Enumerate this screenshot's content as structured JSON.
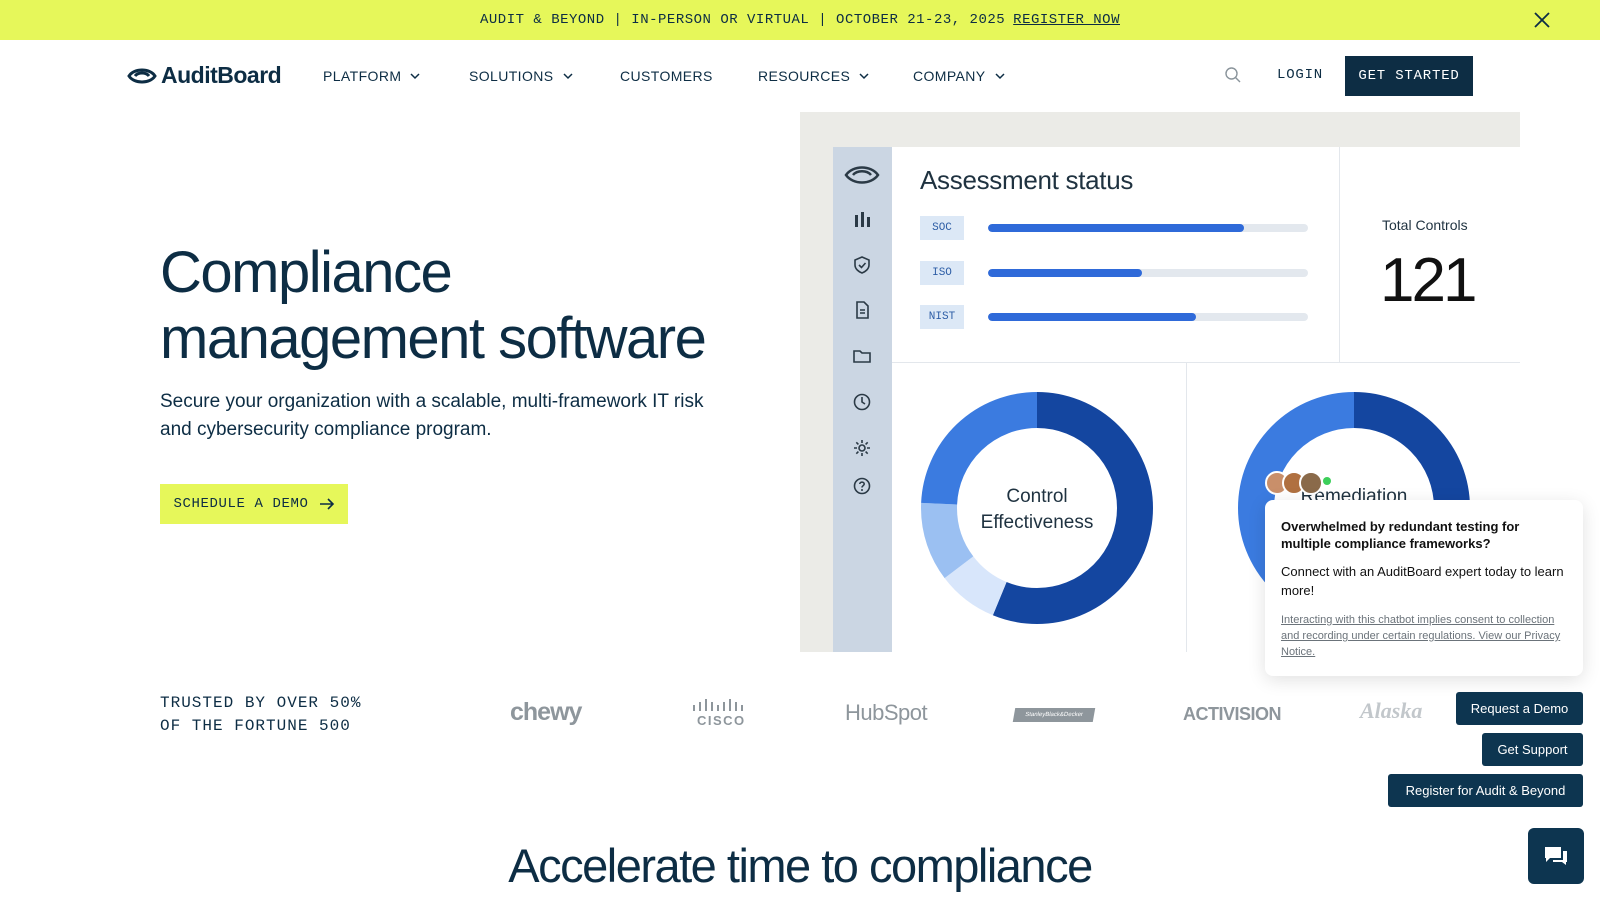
{
  "banner": {
    "text": "AUDIT & BEYOND | IN-PERSON OR VIRTUAL | OCTOBER 21-23, 2025",
    "link": "REGISTER NOW"
  },
  "nav": {
    "logo": "AuditBoard",
    "items": [
      {
        "label": "PLATFORM",
        "has_dropdown": true
      },
      {
        "label": "SOLUTIONS",
        "has_dropdown": true
      },
      {
        "label": "CUSTOMERS",
        "has_dropdown": false
      },
      {
        "label": "RESOURCES",
        "has_dropdown": true
      },
      {
        "label": "COMPANY",
        "has_dropdown": true
      }
    ],
    "login": "LOGIN",
    "cta": "GET STARTED"
  },
  "hero": {
    "title_line1": "Compliance",
    "title_line2": "management software",
    "subtitle": "Secure your organization with a scalable, multi-framework IT risk and cybersecurity compliance program.",
    "cta": "SCHEDULE A DEMO"
  },
  "dashboard": {
    "title": "Assessment status",
    "frameworks": [
      {
        "label": "SOC",
        "progress": 0.8
      },
      {
        "label": "ISO",
        "progress": 0.48
      },
      {
        "label": "NIST",
        "progress": 0.65
      }
    ],
    "total_label": "Total Controls",
    "total_value": "121",
    "donut1_line1": "Control",
    "donut1_line2": "Effectiveness",
    "donut2_label": "Remediation"
  },
  "trusted": {
    "line1": "TRUSTED BY OVER 50%",
    "line2": "OF THE FORTUNE 500",
    "logos": [
      "chewy",
      "CISCO",
      "HubSpot",
      "StanleyBlack&Decker",
      "ACTIVISION",
      "Alaska"
    ]
  },
  "section": {
    "heading": "Accelerate time to compliance"
  },
  "chat": {
    "question": "Overwhelmed by redundant testing for multiple compliance frameworks?",
    "answer": "Connect with an AuditBoard expert today to learn more!",
    "legal": "Interacting with this chatbot implies consent to collection and recording under certain regulations. View our Privacy Notice.",
    "buttons": [
      "Request a Demo",
      "Get Support",
      "Register for Audit & Beyond"
    ]
  },
  "colors": {
    "brand_navy": "#0d2d44",
    "accent_lime": "#e6f75a",
    "chart_blue_dark": "#1446a0",
    "chart_blue": "#2f6ad9"
  }
}
